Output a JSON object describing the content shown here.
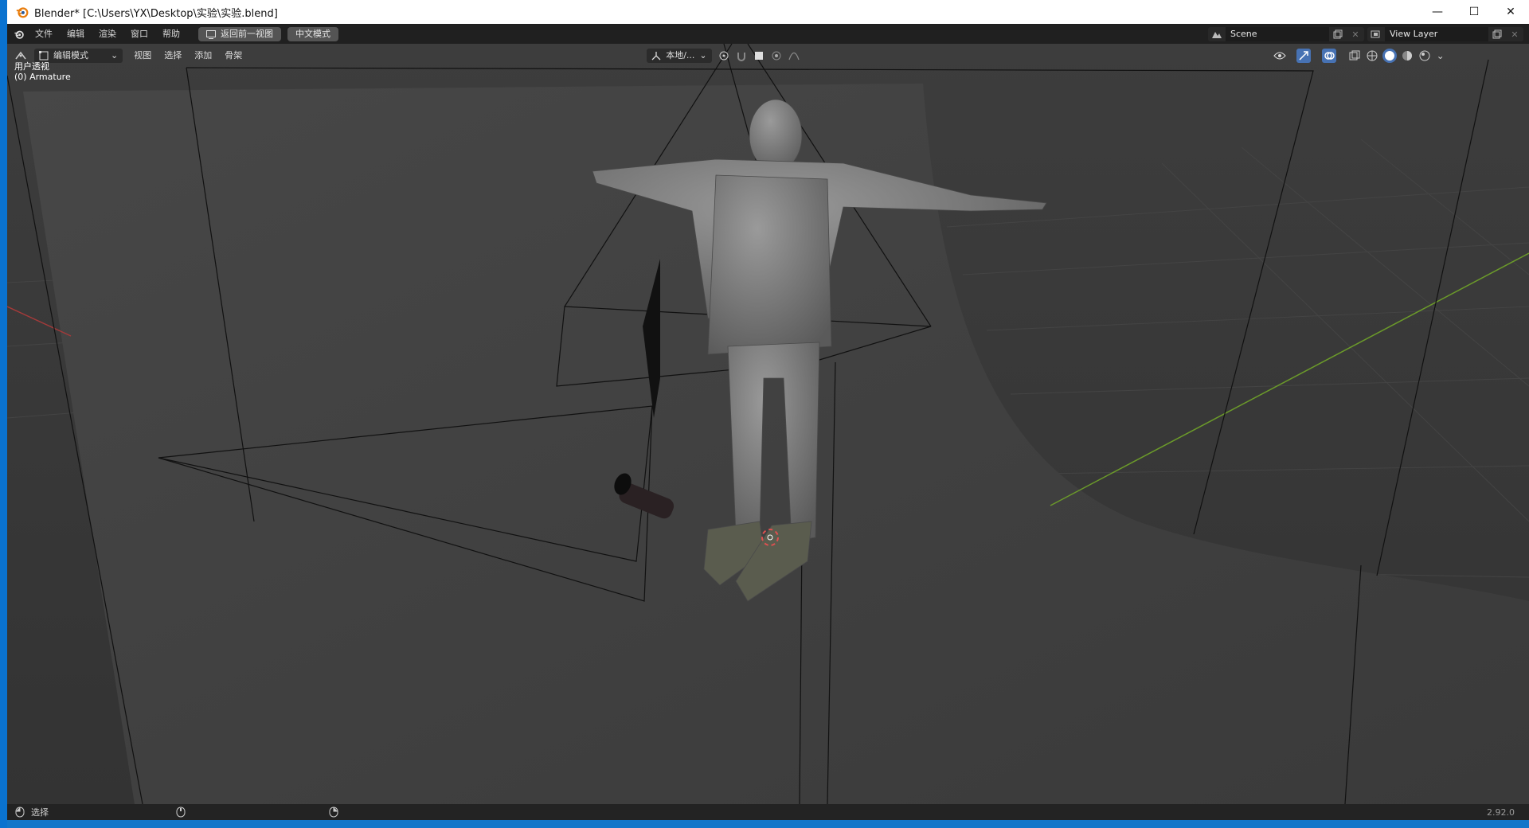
{
  "window": {
    "title": "Blender* [C:\\Users\\YX\\Desktop\\实验\\实验.blend]",
    "controls": [
      "—",
      "☐",
      "✕"
    ]
  },
  "menubar": {
    "items": [
      "文件",
      "编辑",
      "渲染",
      "窗口",
      "帮助"
    ],
    "back_button": "返回前一视图",
    "mode_button": "中文模式",
    "scene_name": "Scene",
    "view_layer": "View Layer"
  },
  "viewport_header": {
    "mode_dropdown": "编辑模式",
    "menus": [
      "视图",
      "选择",
      "添加",
      "骨架"
    ],
    "transform_orientation": "本地/..."
  },
  "viewport_overlay": {
    "view_name": "用户透视",
    "object_info": "(0) Armature"
  },
  "statusbar": {
    "select_label": "选择",
    "version": "2.92.0"
  },
  "colors": {
    "accent_blue": "#4772b3",
    "x_axis": "#a33a3a",
    "y_axis": "#6b9a2a"
  }
}
